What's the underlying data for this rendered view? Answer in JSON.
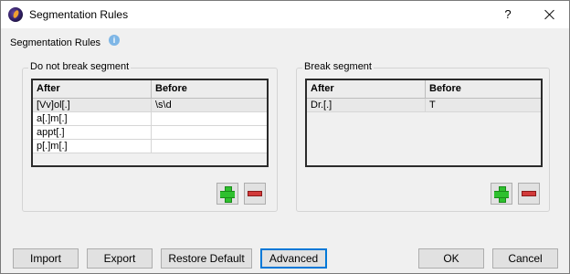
{
  "window": {
    "title": "Segmentation Rules",
    "help_label": "?"
  },
  "heading": {
    "label": "Segmentation Rules",
    "info_glyph": "i"
  },
  "do_not_break": {
    "label": "Do not break segment",
    "columns": [
      "After",
      "Before"
    ],
    "rows": [
      {
        "after": "[Vv]ol[.]",
        "before": "\\s\\d"
      },
      {
        "after": "a[.]m[.]",
        "before": ""
      },
      {
        "after": "appt[.]",
        "before": ""
      },
      {
        "after": "p[.]m[.]",
        "before": ""
      }
    ]
  },
  "break": {
    "label": "Break segment",
    "columns": [
      "After",
      "Before"
    ],
    "rows": [
      {
        "after": "Dr.[.]",
        "before": "T"
      }
    ]
  },
  "buttons": {
    "import": "Import",
    "export": "Export",
    "restore_default": "Restore Default",
    "advanced": "Advanced",
    "ok": "OK",
    "cancel": "Cancel"
  },
  "colors": {
    "add": "#2ec02e",
    "remove": "#d23a3a",
    "focus": "#0078d7"
  }
}
